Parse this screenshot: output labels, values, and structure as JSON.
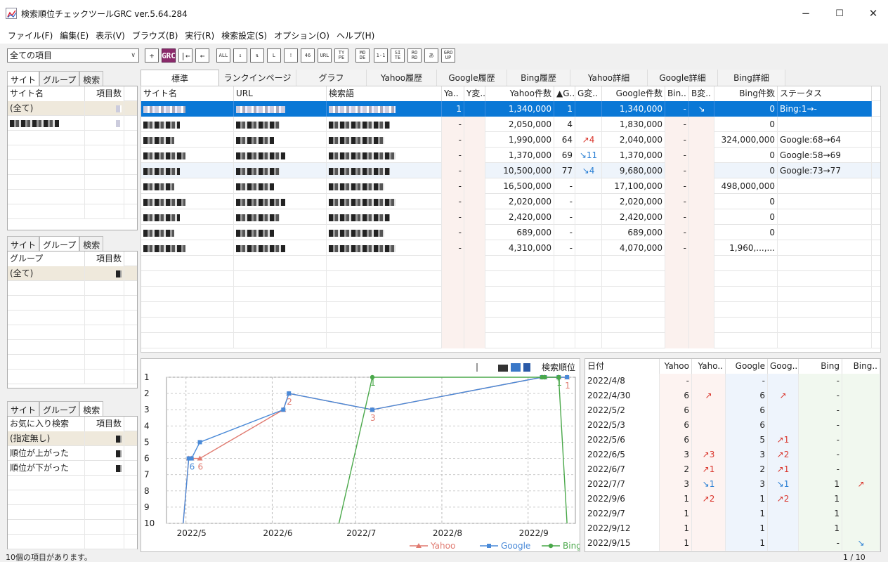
{
  "app": {
    "title": "検索順位チェックツールGRC  ver.5.64.284",
    "min": "−",
    "max": "☐",
    "close": "✕"
  },
  "menu": [
    "ファイル(F)",
    "編集(E)",
    "表示(V)",
    "ブラウズ(B)",
    "実行(R)",
    "検索設定(S)",
    "オプション(O)",
    "ヘルプ(H)"
  ],
  "filter": {
    "value": "全ての項目"
  },
  "toolbar": [
    "+",
    "GRC",
    "|←",
    "←",
    "ALL",
    "↥",
    "⇅",
    "L",
    "!",
    "46",
    "URL",
    "TY PE",
    "MO DE",
    "1-1",
    "SI TE",
    "RO RD",
    "あ",
    "GRO UP"
  ],
  "site_panel": {
    "tabs": [
      "サイト",
      "グループ",
      "検索"
    ],
    "headers": [
      "サイト名",
      "項目数"
    ],
    "rows": [
      "(全て)"
    ]
  },
  "group_panel": {
    "tabs": [
      "サイト",
      "グループ",
      "検索"
    ],
    "headers": [
      "グループ",
      "項目数"
    ],
    "rows": [
      "(全て)"
    ]
  },
  "search_panel": {
    "tabs": [
      "サイト",
      "グループ",
      "検索"
    ],
    "headers": [
      "お気に入り検索",
      "項目数"
    ],
    "rows": [
      "(指定無し)",
      "順位が上がった",
      "順位が下がった"
    ]
  },
  "main_tabs": [
    "標準",
    "ランクインページ",
    "グラフ",
    "Yahoo履歴",
    "Google履歴",
    "Bing履歴",
    "Yahoo詳細",
    "Google詳細",
    "Bing詳細"
  ],
  "table": {
    "headers": [
      "サイト名",
      "URL",
      "検索語",
      "Ya..",
      "Y変..",
      "Yahoo件数",
      "▲G..",
      "G変..",
      "Google件数",
      "Bin..",
      "B変..",
      "Bing件数",
      "ステータス"
    ],
    "rows": [
      {
        "ya": "1",
        "yc": "",
        "yn": "1,340,000",
        "g": "1",
        "gc": "",
        "gn": "1,340,000",
        "b": "-",
        "bc": "↘",
        "bn": "0",
        "st": "Bing:1→-"
      },
      {
        "ya": "-",
        "yc": "",
        "yn": "2,050,000",
        "g": "4",
        "gc": "",
        "gn": "1,830,000",
        "b": "-",
        "bc": "",
        "bn": "0",
        "st": ""
      },
      {
        "ya": "-",
        "yc": "",
        "yn": "1,990,000",
        "g": "64",
        "gc": "↗4",
        "gn": "2,040,000",
        "b": "-",
        "bc": "",
        "bn": "324,000,000",
        "st": "Google:68→64"
      },
      {
        "ya": "-",
        "yc": "",
        "yn": "1,370,000",
        "g": "69",
        "gc": "↘11",
        "gn": "1,370,000",
        "b": "-",
        "bc": "",
        "bn": "0",
        "st": "Google:58→69"
      },
      {
        "ya": "-",
        "yc": "",
        "yn": "10,500,000",
        "g": "77",
        "gc": "↘4",
        "gn": "9,680,000",
        "b": "-",
        "bc": "",
        "bn": "0",
        "st": "Google:73→77"
      },
      {
        "ya": "-",
        "yc": "",
        "yn": "16,500,000",
        "g": "-",
        "gc": "",
        "gn": "17,100,000",
        "b": "-",
        "bc": "",
        "bn": "498,000,000",
        "st": ""
      },
      {
        "ya": "-",
        "yc": "",
        "yn": "2,020,000",
        "g": "-",
        "gc": "",
        "gn": "2,020,000",
        "b": "-",
        "bc": "",
        "bn": "0",
        "st": ""
      },
      {
        "ya": "-",
        "yc": "",
        "yn": "2,420,000",
        "g": "-",
        "gc": "",
        "gn": "2,420,000",
        "b": "-",
        "bc": "",
        "bn": "0",
        "st": ""
      },
      {
        "ya": "-",
        "yc": "",
        "yn": "689,000",
        "g": "-",
        "gc": "",
        "gn": "689,000",
        "b": "-",
        "bc": "",
        "bn": "0",
        "st": ""
      },
      {
        "ya": "-",
        "yc": "",
        "yn": "4,310,000",
        "g": "-",
        "gc": "",
        "gn": "4,070,000",
        "b": "-",
        "bc": "",
        "bn": "1,960,...,...",
        "st": ""
      }
    ]
  },
  "chart_data": {
    "type": "line",
    "title": "検索順位",
    "xlabel": "",
    "ylabel": "",
    "ylim": [
      1,
      10
    ],
    "y_ticks": [
      "1",
      "2",
      "3",
      "4",
      "5",
      "6",
      "7",
      "8",
      "9",
      "10"
    ],
    "x_ticks": [
      "2022/5",
      "2022/6",
      "2022/7",
      "2022/8",
      "2022/9"
    ],
    "series": [
      {
        "name": "Yahoo",
        "color": "#e07a70",
        "points": [
          [
            "2022/4/30",
            10
          ],
          [
            "2022/5/2",
            6
          ],
          [
            "2022/5/3",
            6
          ],
          [
            "2022/5/6",
            6
          ],
          [
            "2022/6/5",
            3
          ],
          [
            "2022/6/7",
            2
          ],
          [
            "2022/7/7",
            3
          ],
          [
            "2022/9/6",
            1
          ],
          [
            "2022/9/7",
            1
          ],
          [
            "2022/9/12",
            1
          ],
          [
            "2022/9/15",
            1
          ]
        ],
        "labels": [
          [
            "2022/5/6",
            6,
            "6"
          ],
          [
            "2022/6/7",
            2,
            "2"
          ],
          [
            "2022/7/7",
            3,
            "3"
          ],
          [
            "2022/9/15",
            1,
            "1"
          ]
        ]
      },
      {
        "name": "Google",
        "color": "#4a8ad8",
        "points": [
          [
            "2022/4/30",
            10
          ],
          [
            "2022/5/2",
            6
          ],
          [
            "2022/5/3",
            6
          ],
          [
            "2022/5/6",
            5
          ],
          [
            "2022/6/5",
            3
          ],
          [
            "2022/6/7",
            2
          ],
          [
            "2022/7/7",
            3
          ],
          [
            "2022/9/6",
            1
          ],
          [
            "2022/9/7",
            1
          ],
          [
            "2022/9/12",
            1
          ],
          [
            "2022/9/15",
            1
          ]
        ],
        "labels": [
          [
            "2022/5/3",
            6,
            "6"
          ]
        ]
      },
      {
        "name": "Bing",
        "color": "#4aa84a",
        "points": [
          [
            "2022/6/25",
            10
          ],
          [
            "2022/7/7",
            1
          ],
          [
            "2022/9/6",
            1
          ],
          [
            "2022/9/7",
            1
          ],
          [
            "2022/9/12",
            1
          ],
          [
            "2022/9/15",
            10
          ]
        ],
        "labels": [
          [
            "2022/7/7",
            1,
            "1"
          ],
          [
            "2022/9/12",
            1,
            "1"
          ]
        ]
      }
    ]
  },
  "history": {
    "headers": [
      "日付",
      "Yahoo",
      "Yaho..",
      "Google",
      "Goog..",
      "Bing",
      "Bing.."
    ],
    "rows": [
      [
        "2022/4/8",
        "-",
        "",
        "-",
        "",
        "-",
        ""
      ],
      [
        "2022/4/30",
        "6",
        "↗",
        "6",
        "↗",
        "-",
        ""
      ],
      [
        "2022/5/2",
        "6",
        "",
        "6",
        "",
        "-",
        ""
      ],
      [
        "2022/5/3",
        "6",
        "",
        "6",
        "",
        "-",
        ""
      ],
      [
        "2022/5/6",
        "6",
        "",
        "5",
        "↗1",
        "-",
        ""
      ],
      [
        "2022/6/5",
        "3",
        "↗3",
        "3",
        "↗2",
        "-",
        ""
      ],
      [
        "2022/6/7",
        "2",
        "↗1",
        "2",
        "↗1",
        "-",
        ""
      ],
      [
        "2022/7/7",
        "3",
        "↘1",
        "3",
        "↘1",
        "1",
        "↗"
      ],
      [
        "2022/9/6",
        "1",
        "↗2",
        "1",
        "↗2",
        "1",
        ""
      ],
      [
        "2022/9/7",
        "1",
        "",
        "1",
        "",
        "1",
        ""
      ],
      [
        "2022/9/12",
        "1",
        "",
        "1",
        "",
        "1",
        ""
      ],
      [
        "2022/9/15",
        "1",
        "",
        "1",
        "",
        "-",
        "↘"
      ]
    ]
  },
  "status": {
    "left": "10個の項目があります。",
    "right": "1 / 10"
  }
}
